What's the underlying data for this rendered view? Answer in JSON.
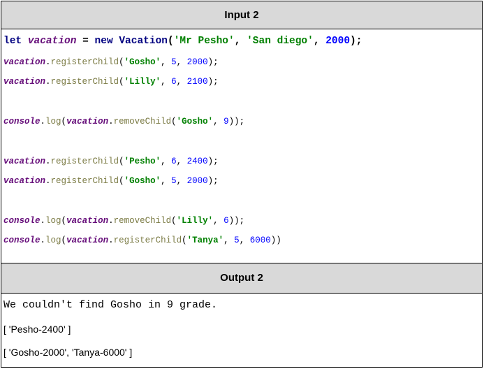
{
  "input_header": "Input 2",
  "output_header": "Output 2",
  "code": {
    "l1": {
      "let": "let",
      "var": "vacation",
      "eq": " = ",
      "new": "new",
      "cls": "Vacation",
      "p1": "(",
      "s1": "'Mr Pesho'",
      "c1": ", ",
      "s2": "'San diego'",
      "c2": ", ",
      "n1": "2000",
      "end": ");"
    },
    "l2": {
      "var": "vacation",
      "dot": ".",
      "meth": "registerChild",
      "p": "(",
      "s": "'Gosho'",
      "c1": ", ",
      "n1": "5",
      "c2": ", ",
      "n2": "2000",
      "end": ");"
    },
    "l3": {
      "var": "vacation",
      "dot": ".",
      "meth": "registerChild",
      "p": "(",
      "s": "'Lilly'",
      "c1": ", ",
      "n1": "6",
      "c2": ", ",
      "n2": "2100",
      "end": ");"
    },
    "l4": {
      "con": "console",
      "dot": ".",
      "log": "log",
      "p": "(",
      "var": "vacation",
      "dot2": ".",
      "meth": "removeChild",
      "p2": "(",
      "s": "'Gosho'",
      "c1": ", ",
      "n1": "9",
      "end": "));"
    },
    "l5": {
      "var": "vacation",
      "dot": ".",
      "meth": "registerChild",
      "p": "(",
      "s": "'Pesho'",
      "c1": ", ",
      "n1": "6",
      "c2": ", ",
      "n2": "2400",
      "end": ");"
    },
    "l6": {
      "var": "vacation",
      "dot": ".",
      "meth": "registerChild",
      "p": "(",
      "s": "'Gosho'",
      "c1": ", ",
      "n1": "5",
      "c2": ", ",
      "n2": "2000",
      "end": ");"
    },
    "l7": {
      "con": "console",
      "dot": ".",
      "log": "log",
      "p": "(",
      "var": "vacation",
      "dot2": ".",
      "meth": "removeChild",
      "p2": "(",
      "s": "'Lilly'",
      "c1": ", ",
      "n1": "6",
      "end": "));"
    },
    "l8": {
      "con": "console",
      "dot": ".",
      "log": "log",
      "p": "(",
      "var": "vacation",
      "dot2": ".",
      "meth": "registerChild",
      "p2": "(",
      "s": "'Tanya'",
      "c1": ", ",
      "n1": "5",
      "c2": ", ",
      "n2": "6000",
      "end": "))"
    }
  },
  "output": {
    "line1": "We couldn't find Gosho in 9 grade.",
    "line2": "[ 'Pesho-2400' ]",
    "line3": "[ 'Gosho-2000', 'Tanya-6000' ]"
  }
}
